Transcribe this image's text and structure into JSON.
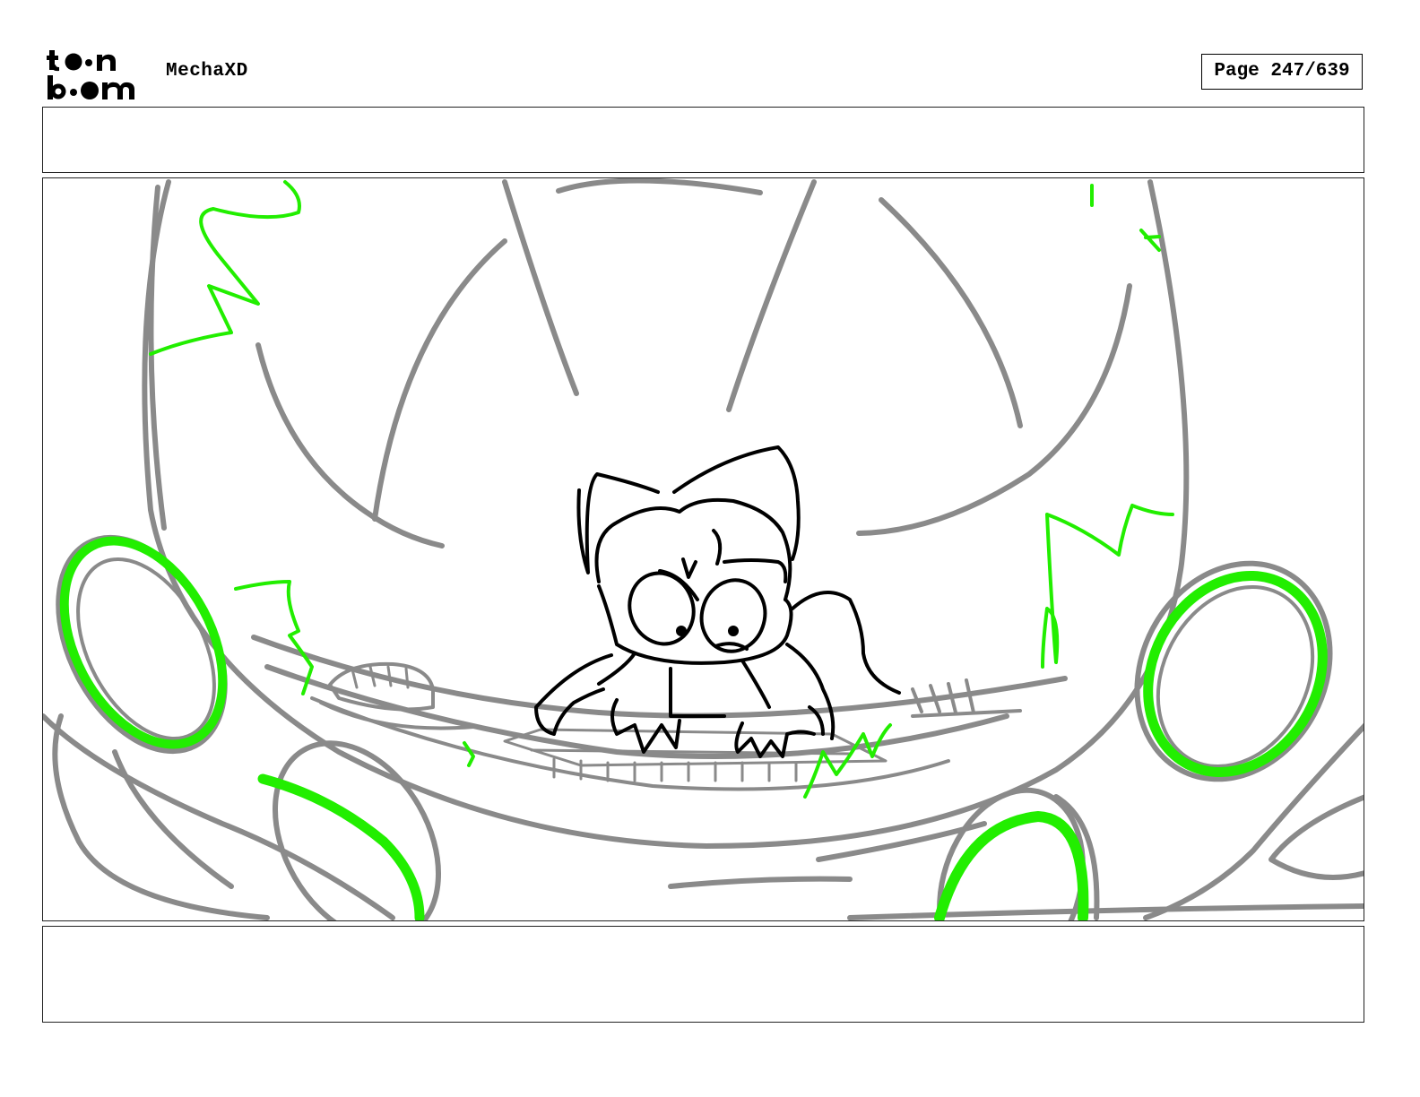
{
  "header": {
    "project_title": "MechaXD",
    "page_label": "Page 247/639"
  },
  "top_notes": {
    "text": ""
  },
  "bottom_notes": {
    "text": ""
  },
  "colors": {
    "sketch_gray": "#8a8a8a",
    "sketch_green": "#22ee00",
    "character_black": "#000000"
  }
}
